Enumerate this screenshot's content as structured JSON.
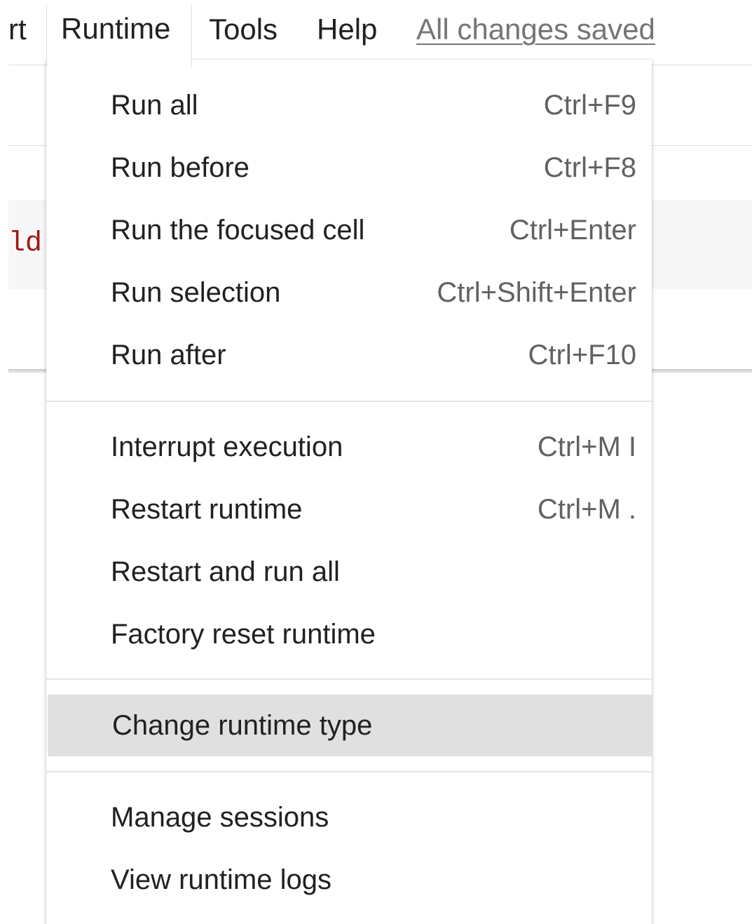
{
  "menubar": {
    "partial_item": "rt",
    "items": [
      "Runtime",
      "Tools",
      "Help"
    ],
    "save_status": "All changes saved"
  },
  "code_cell": {
    "visible_text": "ld'"
  },
  "runtime_menu": {
    "groups": [
      [
        {
          "label": "Run all",
          "shortcut": "Ctrl+F9"
        },
        {
          "label": "Run before",
          "shortcut": "Ctrl+F8"
        },
        {
          "label": "Run the focused cell",
          "shortcut": "Ctrl+Enter"
        },
        {
          "label": "Run selection",
          "shortcut": "Ctrl+Shift+Enter"
        },
        {
          "label": "Run after",
          "shortcut": "Ctrl+F10"
        }
      ],
      [
        {
          "label": "Interrupt execution",
          "shortcut": "Ctrl+M I"
        },
        {
          "label": "Restart runtime",
          "shortcut": "Ctrl+M ."
        },
        {
          "label": "Restart and run all",
          "shortcut": ""
        },
        {
          "label": "Factory reset runtime",
          "shortcut": ""
        }
      ],
      [
        {
          "label": "Change runtime type",
          "shortcut": "",
          "highlighted": true
        }
      ],
      [
        {
          "label": "Manage sessions",
          "shortcut": ""
        },
        {
          "label": "View runtime logs",
          "shortcut": ""
        }
      ]
    ]
  },
  "colors": {
    "highlight": "#e0e0e0",
    "code_string": "#a31515",
    "save_status": "#757575"
  }
}
